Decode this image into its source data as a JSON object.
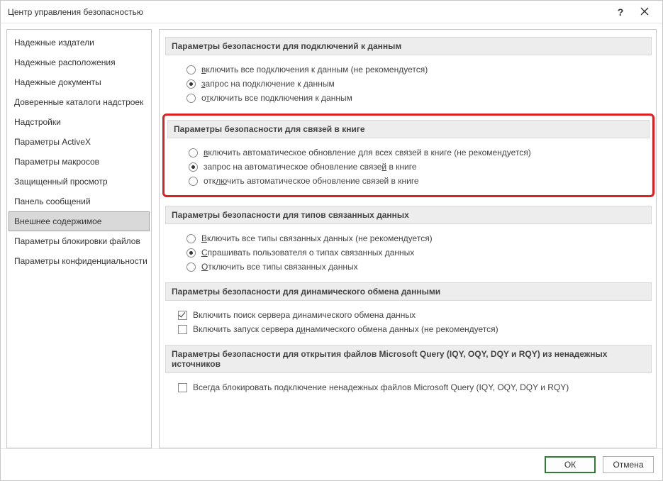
{
  "titlebar": {
    "title": "Центр управления безопасностью"
  },
  "sidebar": {
    "items": [
      {
        "label": "Надежные издатели"
      },
      {
        "label": "Надежные расположения"
      },
      {
        "label": "Надежные документы"
      },
      {
        "label": "Доверенные каталоги надстроек"
      },
      {
        "label": "Надстройки"
      },
      {
        "label": "Параметры ActiveX"
      },
      {
        "label": "Параметры макросов"
      },
      {
        "label": "Защищенный просмотр"
      },
      {
        "label": "Панель сообщений"
      },
      {
        "label": "Внешнее содержимое",
        "selected": true
      },
      {
        "label": "Параметры блокировки файлов"
      },
      {
        "label": "Параметры конфиденциальности"
      }
    ]
  },
  "sections": {
    "data_conn": {
      "title": "Параметры безопасности для подключений к данным",
      "opts": [
        {
          "label_pre": "",
          "u": "в",
          "label_post": "ключить все подключения к данным (не рекомендуется)",
          "checked": false
        },
        {
          "label_pre": "",
          "u": "з",
          "label_post": "апрос на подключение к данным",
          "checked": true
        },
        {
          "label_pre": "о",
          "u": "т",
          "label_post": "ключить все подключения к данным",
          "checked": false
        }
      ]
    },
    "workbook_links": {
      "title": "Параметры безопасности для связей в книге",
      "opts": [
        {
          "label_pre": "",
          "u": "в",
          "label_post": "ключить автоматическое обновление для всех связей в книге (не рекомендуется)",
          "checked": false
        },
        {
          "label_pre": "запрос на автоматическое обновление связе",
          "u": "й",
          "label_post": " в книге",
          "checked": true
        },
        {
          "label_pre": "отк",
          "u": "лю",
          "label_post": "чить автоматическое обновление связей в книге",
          "checked": false
        }
      ]
    },
    "linked_types": {
      "title": "Параметры безопасности для типов связанных данных",
      "opts": [
        {
          "label_pre": "",
          "u": "В",
          "label_post": "ключить все типы связанных данных (не рекомендуется)",
          "checked": false
        },
        {
          "label_pre": "",
          "u": "С",
          "label_post": "прашивать пользователя о типах связанных данных",
          "checked": true
        },
        {
          "label_pre": "",
          "u": "О",
          "label_post": "тключить все типы связанных данных",
          "checked": false
        }
      ]
    },
    "dde": {
      "title": "Параметры безопасности для динамического обмена данными",
      "opts": [
        {
          "label_pre": "Включить поиск сервера ",
          "u": "д",
          "label_post": "инамического обмена данных",
          "checked": true
        },
        {
          "label_pre": "Включить запуск сервера д",
          "u": "и",
          "label_post": "намического обмена данных (не рекомендуется)",
          "checked": false
        }
      ]
    },
    "msquery": {
      "title": "Параметры безопасности для открытия файлов Microsoft Query (IQY, OQY, DQY и RQY) из ненадежных источников",
      "opts": [
        {
          "label_pre": "Всегда блокировать подключение ненадежных файлов Microsoft Query (IQY, OQY, DQY и RQY)",
          "u": "",
          "label_post": "",
          "checked": false
        }
      ]
    }
  },
  "footer": {
    "ok": "ОК",
    "cancel": "Отмена"
  }
}
